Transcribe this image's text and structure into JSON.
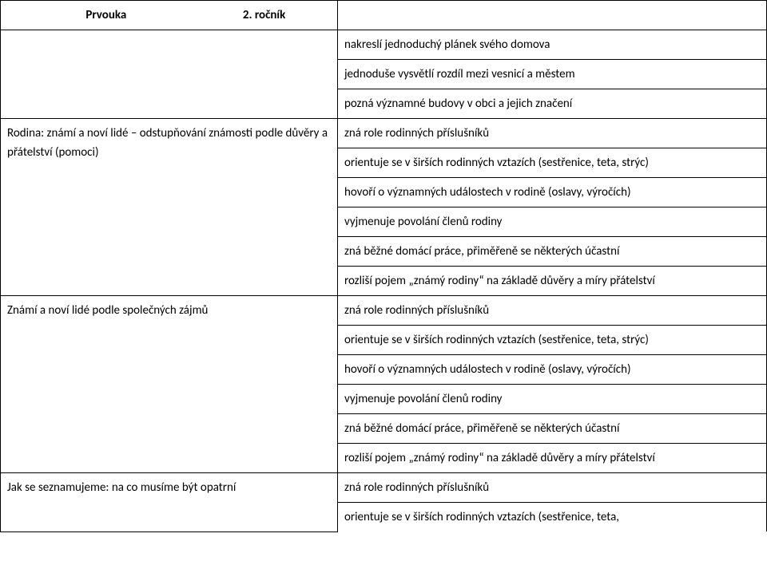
{
  "header": {
    "subject": "Prvouka",
    "grade": "2. ročník"
  },
  "rows": [
    {
      "left": "",
      "right": "nakreslí jednoduchý plánek svého domova",
      "left_rowspan": 1
    },
    {
      "left": "",
      "right": "jednoduše vysvětlí rozdíl mezi vesnicí a městem"
    },
    {
      "left": "",
      "right": "pozná významné budovy v obci a jejich značení"
    },
    {
      "left": "Rodina: známí a noví lidé – odstupňování známosti podle důvěry a přátelství (pomoci)",
      "left_rowspan": 7,
      "right": "zná role rodinných příslušníků"
    },
    {
      "right": "orientuje se v širších rodinných vztazích (sestřenice, teta, strýc)",
      "justify": true
    },
    {
      "right": "hovoří o významných událostech v rodině (oslavy, výročích)"
    },
    {
      "right": "vyjmenuje povolání členů rodiny"
    },
    {
      "right": "zná běžné domácí práce, přiměřeně se některých účastní"
    },
    {
      "right": "rozliší pojem „známý rodiny“ na základě důvěry a míry přátelství",
      "justify": true
    },
    {
      "left": "Známí a noví lidé podle společných zájmů",
      "left_rowspan": 7,
      "starts_new_left": true,
      "right": "zná role rodinných příslušníků"
    },
    {
      "right": "orientuje se v širších rodinných vztazích (sestřenice, teta, strýc)",
      "justify": true
    },
    {
      "right": "hovoří o významných událostech v rodině (oslavy, výročích)"
    },
    {
      "right": "vyjmenuje povolání členů rodiny"
    },
    {
      "right": "zná běžné domácí práce, přiměřeně se některých účastní"
    },
    {
      "right": "rozliší pojem „známý rodiny“ na základě důvěry a míry přátelství",
      "justify": true
    },
    {
      "left": "Jak se seznamujeme: na co musíme být opatrní",
      "left_rowspan": 2,
      "starts_new_left": true,
      "right": "zná role rodinných příslušníků"
    },
    {
      "right": "orientuje se v širších rodinných vztazích (sestřenice, teta,"
    }
  ]
}
